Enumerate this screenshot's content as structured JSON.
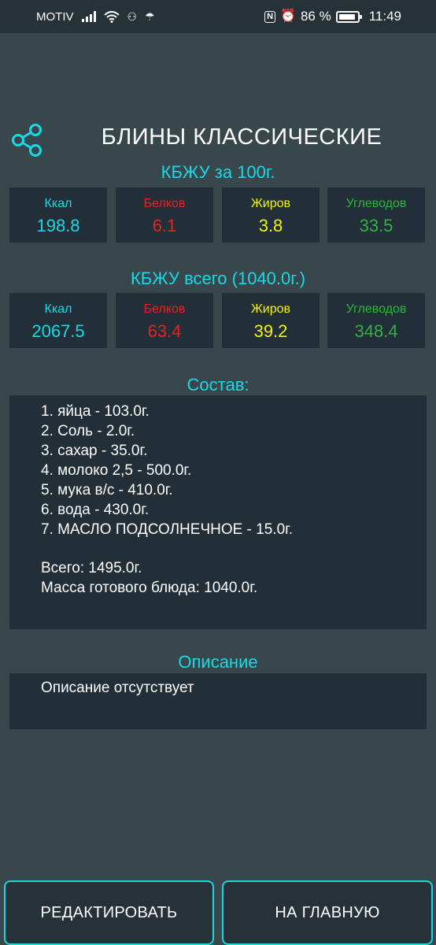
{
  "status_bar": {
    "carrier": "MOTIV",
    "battery": "86 %",
    "time": "11:49",
    "icons": [
      "signal-icon",
      "wifi-icon",
      "usb-icon",
      "umbrella-icon",
      "nfc-icon",
      "alarm-icon",
      "battery-icon"
    ]
  },
  "header": {
    "title": "БЛИНЫ КЛАССИЧЕСКИЕ",
    "share_icon": "share-icon"
  },
  "per100": {
    "heading": "КБЖУ за 100г.",
    "items": [
      {
        "label": "Ккал",
        "value": "198.8"
      },
      {
        "label": "Белков",
        "value": "6.1"
      },
      {
        "label": "Жиров",
        "value": "3.8"
      },
      {
        "label": "Углеводов",
        "value": "33.5"
      }
    ]
  },
  "total": {
    "heading": "КБЖУ всего (1040.0г.)",
    "items": [
      {
        "label": "Ккал",
        "value": "2067.5"
      },
      {
        "label": "Белков",
        "value": "63.4"
      },
      {
        "label": "Жиров",
        "value": "39.2"
      },
      {
        "label": "Углеводов",
        "value": "348.4"
      }
    ]
  },
  "colors": {
    "accent": "#18d9e6",
    "kcal": "#18d9e6",
    "protein": "#e52222",
    "fat": "#f2f20c",
    "carbs": "#31b241",
    "background": "#37474c",
    "card": "#232f38"
  },
  "composition": {
    "heading": "Состав:",
    "ingredients": [
      "1. яйца - 103.0г.",
      "2. Соль - 2.0г.",
      "3. сахар - 35.0г.",
      "4. молоко 2,5 - 500.0г.",
      "5. мука в/с - 410.0г.",
      "6. вода - 430.0г.",
      "7. МАСЛО ПОДСОЛНЕЧНОЕ - 15.0г."
    ],
    "total_weight": "Всего: 1495.0г.",
    "final_weight": "Масса готового блюда: 1040.0г."
  },
  "description": {
    "heading": "Описание",
    "text": "Описание отсутствует"
  },
  "buttons": {
    "edit": "РЕДАКТИРОВАТЬ",
    "home": "НА ГЛАВНУЮ"
  }
}
